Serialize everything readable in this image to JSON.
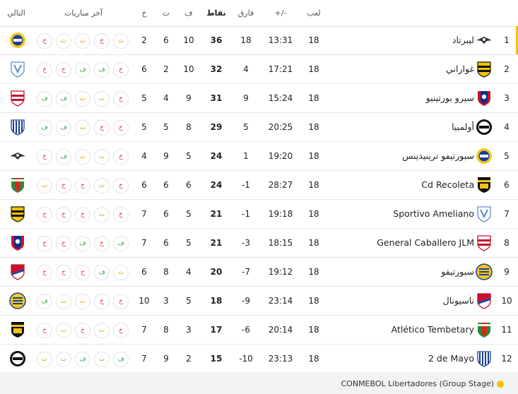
{
  "header": {
    "next": "التالي",
    "last_matches": "آخر مباريات",
    "lost": "خ",
    "drawn": "ت",
    "won": "ف",
    "points": "نقاط",
    "diff": "فارق",
    "goals": "+/-",
    "played": "لعب"
  },
  "results": {
    "W": "ف",
    "D": "ت",
    "L": "خ"
  },
  "colors": {
    "win": "#2e9e3e",
    "draw": "#c9a300",
    "loss": "#d64545",
    "qualify": "#f2c200"
  },
  "rows": [
    {
      "rank": "1",
      "team": "ليبرتاد",
      "played": "18",
      "goals": "13:31",
      "diff": "18",
      "points": "36",
      "won": "10",
      "drawn": "6",
      "lost": "2",
      "form": [
        "L",
        "D",
        "D",
        "L",
        "D"
      ],
      "logo": "libertad-logo",
      "next": "sportivo-trinidense-logo"
    },
    {
      "rank": "2",
      "team": "غواراني",
      "played": "18",
      "goals": "17:21",
      "diff": "4",
      "points": "32",
      "won": "10",
      "drawn": "2",
      "lost": "6",
      "form": [
        "L",
        "L",
        "W",
        "W",
        "L"
      ],
      "logo": "guarani-logo",
      "next": "sportivo-ameliano-logo"
    },
    {
      "rank": "3",
      "team": "سيرو بورتينيو",
      "played": "18",
      "goals": "15:24",
      "diff": "9",
      "points": "31",
      "won": "9",
      "drawn": "4",
      "lost": "5",
      "form": [
        "W",
        "W",
        "D",
        "D",
        "L"
      ],
      "logo": "cerro-porteno-logo",
      "next": "general-caballero-logo"
    },
    {
      "rank": "4",
      "team": "أولمبيا",
      "played": "18",
      "goals": "20:25",
      "diff": "5",
      "points": "29",
      "won": "8",
      "drawn": "5",
      "lost": "5",
      "form": [
        "W",
        "W",
        "D",
        "L",
        "L"
      ],
      "logo": "olimpia-logo",
      "next": "2-de-mayo-logo"
    },
    {
      "rank": "5",
      "team": "سبورتيفو ترينيدينس",
      "played": "18",
      "goals": "19:20",
      "diff": "1",
      "points": "24",
      "won": "5",
      "drawn": "9",
      "lost": "4",
      "form": [
        "L",
        "W",
        "D",
        "D",
        "L"
      ],
      "logo": "sportivo-trinidense-logo",
      "next": "libertad-logo"
    },
    {
      "rank": "6",
      "team": "Cd Recoleta",
      "played": "18",
      "goals": "28:27",
      "diff": "-1",
      "points": "24",
      "won": "6",
      "drawn": "6",
      "lost": "6",
      "form": [
        "D",
        "L",
        "L",
        "D",
        "L"
      ],
      "logo": "recoleta-logo",
      "next": "atletico-tembetary-logo"
    },
    {
      "rank": "7",
      "team": "Sportivo Ameliano",
      "played": "18",
      "goals": "19:18",
      "diff": "-1",
      "points": "21",
      "won": "5",
      "drawn": "6",
      "lost": "7",
      "form": [
        "L",
        "L",
        "L",
        "D",
        "L"
      ],
      "logo": "sportivo-ameliano-logo",
      "next": "guarani-logo"
    },
    {
      "rank": "8",
      "team": "General Caballero JLM",
      "played": "18",
      "goals": "18:15",
      "diff": "-3",
      "points": "21",
      "won": "5",
      "drawn": "6",
      "lost": "7",
      "form": [
        "L",
        "L",
        "W",
        "L",
        "W"
      ],
      "logo": "general-caballero-logo",
      "next": "cerro-porteno-logo"
    },
    {
      "rank": "9",
      "team": "سبورتيفو",
      "played": "18",
      "goals": "19:12",
      "diff": "-7",
      "points": "20",
      "won": "4",
      "drawn": "8",
      "lost": "6",
      "form": [
        "L",
        "L",
        "L",
        "W",
        "D"
      ],
      "logo": "sportivo-luqueno-logo",
      "next": "nacional-logo"
    },
    {
      "rank": "10",
      "team": "ناسيونال",
      "played": "18",
      "goals": "23:14",
      "diff": "-9",
      "points": "18",
      "won": "5",
      "drawn": "3",
      "lost": "10",
      "form": [
        "W",
        "D",
        "D",
        "L",
        "L"
      ],
      "logo": "nacional-logo",
      "next": "sportivo-luqueno-logo"
    },
    {
      "rank": "11",
      "team": "Atlético Tembetary",
      "played": "18",
      "goals": "20:14",
      "diff": "-6",
      "points": "17",
      "won": "3",
      "drawn": "8",
      "lost": "7",
      "form": [
        "L",
        "D",
        "L",
        "D",
        "L"
      ],
      "logo": "atletico-tembetary-logo",
      "next": "recoleta-logo"
    },
    {
      "rank": "12",
      "team": "2 de Mayo",
      "played": "18",
      "goals": "23:13",
      "diff": "-10",
      "points": "15",
      "won": "2",
      "drawn": "9",
      "lost": "7",
      "form": [
        "D",
        "D",
        "W",
        "D",
        "W"
      ],
      "logo": "2-de-mayo-logo",
      "next": "olimpia-logo"
    }
  ],
  "legend": {
    "label": "CONMEBOL Libertadores (Group Stage)"
  }
}
